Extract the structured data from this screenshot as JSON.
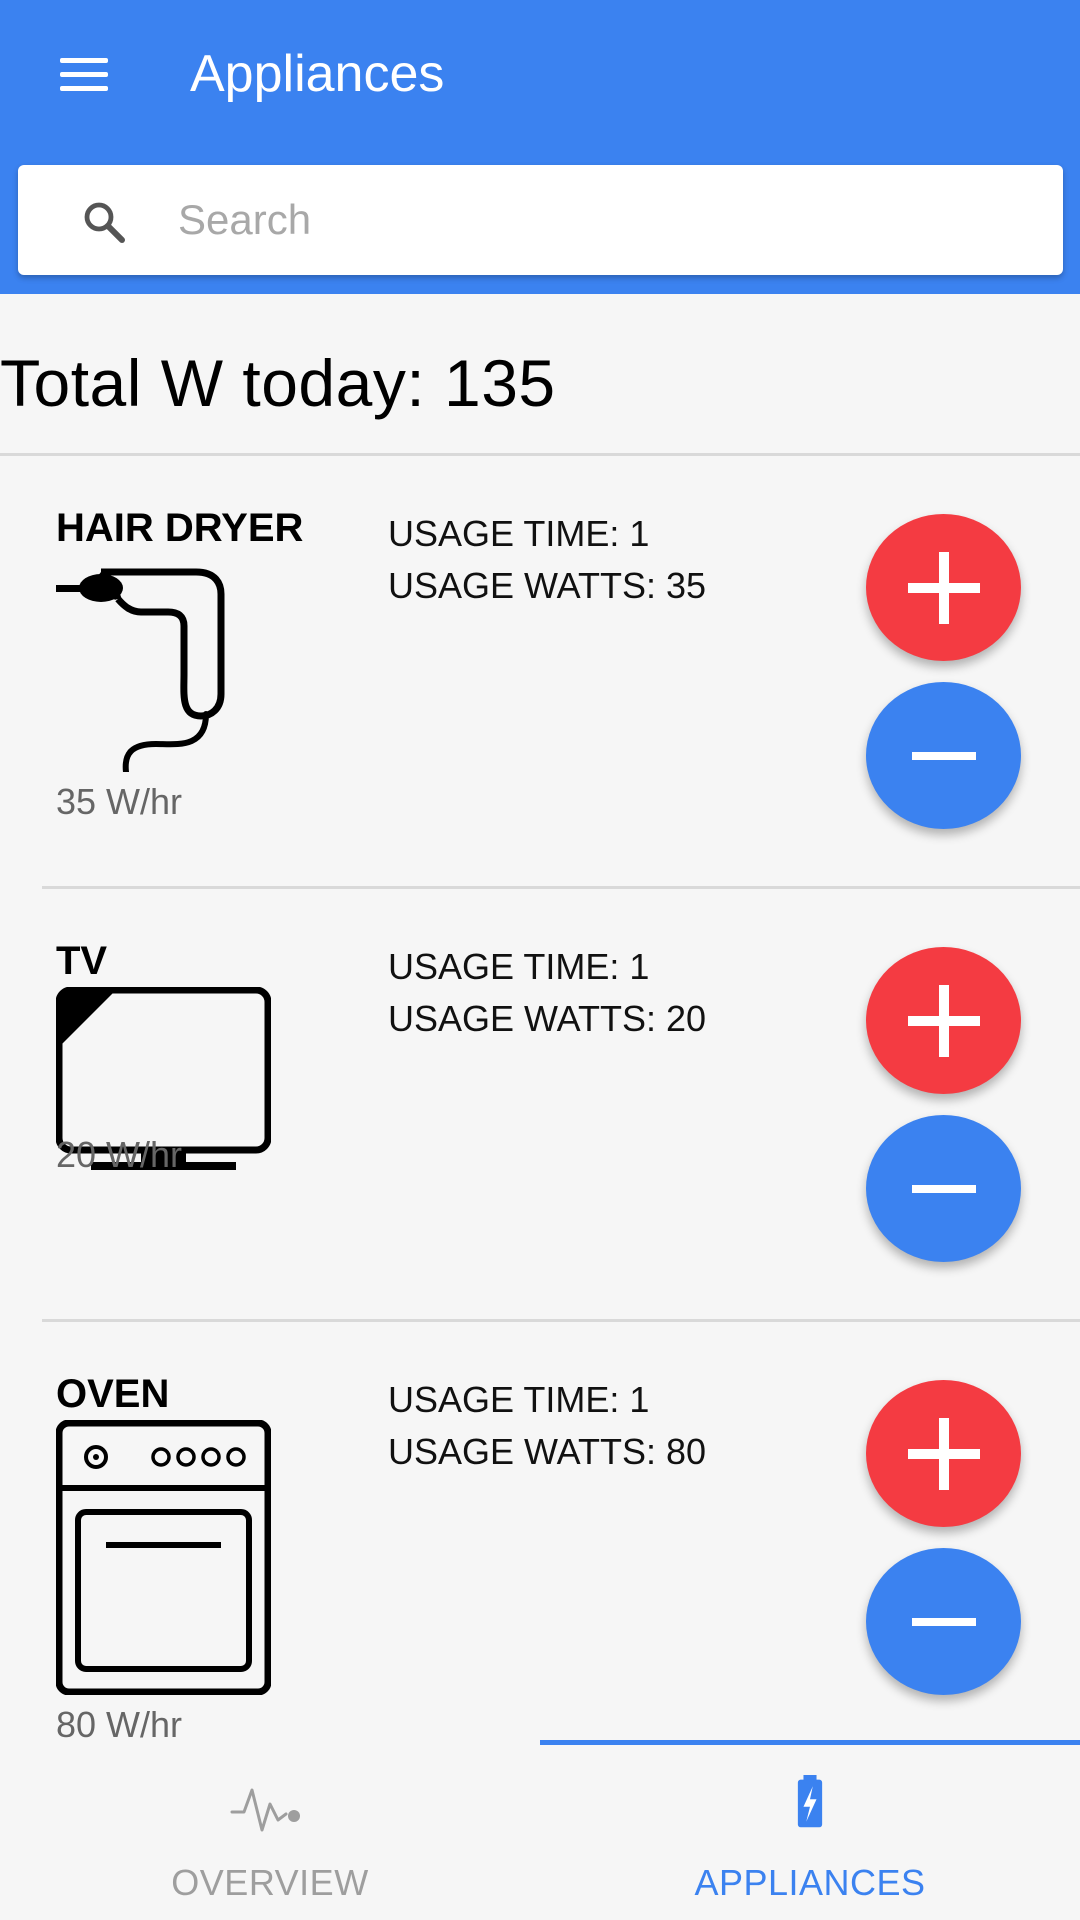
{
  "colors": {
    "primary": "#3b82f0",
    "add": "#f43b42",
    "remove": "#3b82f0",
    "inactive": "#9e9e9e"
  },
  "header": {
    "title": "Appliances",
    "menu_icon": "hamburger-menu-icon"
  },
  "search": {
    "placeholder": "Search",
    "value": "",
    "icon": "search-icon"
  },
  "summary": {
    "total_text": "Total W today: 135"
  },
  "appliances": [
    {
      "name": "HAIR DRYER",
      "icon": "hair-dryer-icon",
      "usage_time": "USAGE TIME: 1",
      "usage_watts": "USAGE WATTS: 35",
      "rate": "35 W/hr"
    },
    {
      "name": "TV",
      "icon": "tv-icon",
      "usage_time": "USAGE TIME: 1",
      "usage_watts": "USAGE WATTS: 20",
      "rate": "20 W/hr"
    },
    {
      "name": "OVEN",
      "icon": "oven-icon",
      "usage_time": "USAGE TIME: 1",
      "usage_watts": "USAGE WATTS: 80",
      "rate": "80 W/hr"
    }
  ],
  "bottom_nav": {
    "tabs": [
      {
        "label": "OVERVIEW",
        "icon": "pulse-icon",
        "active": false
      },
      {
        "label": "APPLIANCES",
        "icon": "battery-charging-icon",
        "active": true
      }
    ]
  }
}
